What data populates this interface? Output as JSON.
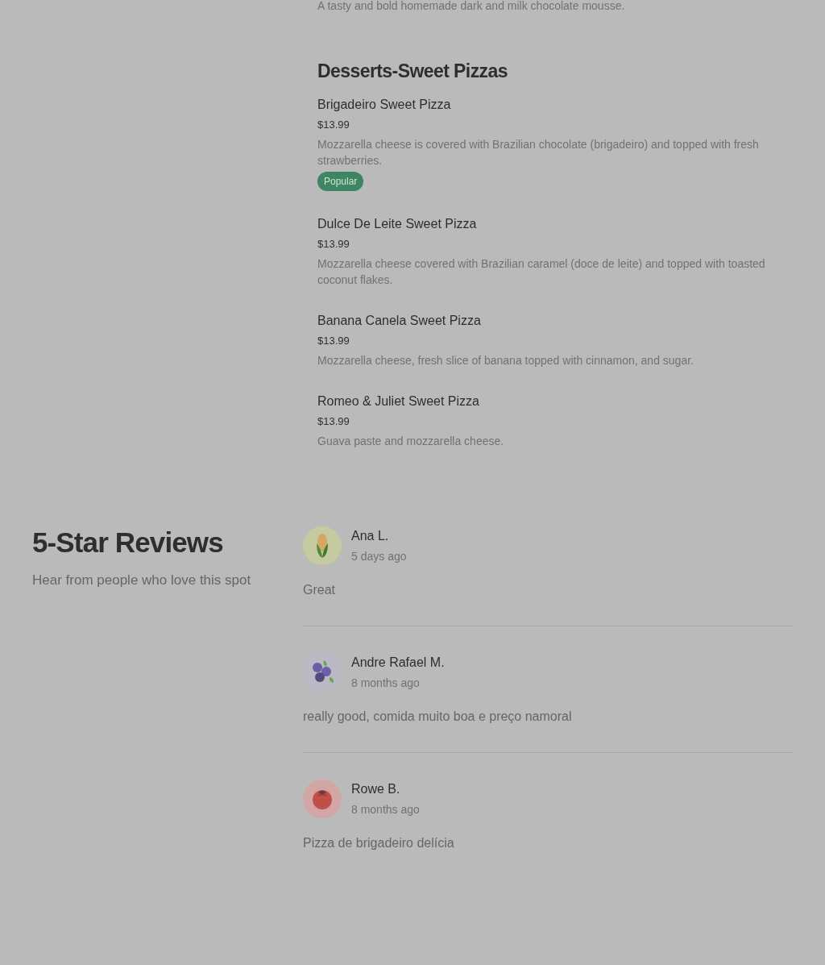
{
  "menu": {
    "previous_item_description": "A tasty and bold homemade dark and milk chocolate mousse.",
    "section": {
      "title": "Desserts-Sweet Pizzas",
      "items": [
        {
          "name": "Brigadeiro Sweet Pizza",
          "price": "$13.99",
          "description": "Mozzarella cheese is covered with Brazilian chocolate (brigadeiro) and topped with fresh strawberries.",
          "badge": "Popular"
        },
        {
          "name": "Dulce De Leite Sweet Pizza",
          "price": "$13.99",
          "description": "Mozzarella cheese covered with Brazilian caramel (doce de leite) and topped with toasted coconut flakes."
        },
        {
          "name": "Banana Canela Sweet Pizza",
          "price": "$13.99",
          "description": "Mozzarella cheese, fresh slice of banana topped with cinnamon, and sugar."
        },
        {
          "name": "Romeo & Juliet Sweet Pizza",
          "price": "$13.99",
          "description": "Guava paste and mozzarella cheese."
        }
      ]
    }
  },
  "reviews": {
    "title": "5-Star Reviews",
    "subtitle": "Hear from people who love this spot",
    "items": [
      {
        "author": "Ana L.",
        "time": "5 days ago",
        "text": "Great"
      },
      {
        "author": "Andre Rafael M.",
        "time": "8 months ago",
        "text": "really good, comida muito boa e preço namoral"
      },
      {
        "author": "Rowe B.",
        "time": "8 months ago",
        "text": "Pizza de brigadeiro delícia"
      }
    ]
  }
}
